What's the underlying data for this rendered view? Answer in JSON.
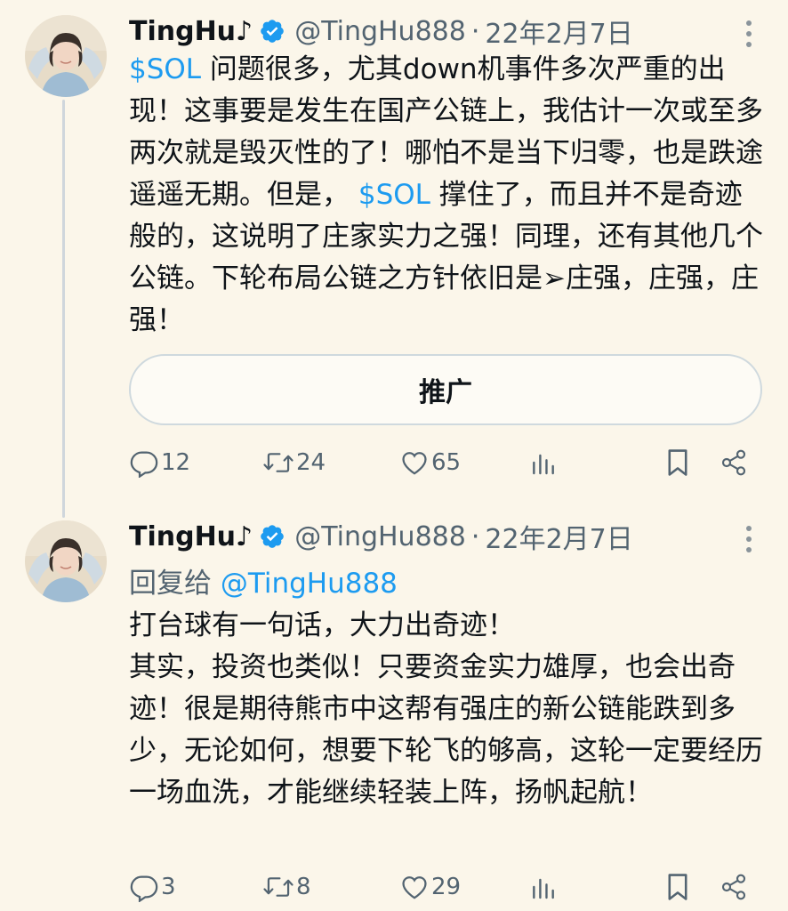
{
  "tweets": [
    {
      "author": {
        "name": "TingHu♪",
        "handle": "@TingHu888",
        "date": "22年2月7日"
      },
      "body": {
        "cashtag1": "$SOL",
        "part1": " 问题很多，尤其down机事件多次严重的出现！这事要是发生在国产公链上，我估计一次或至多两次就是毁灭性的了！哪怕不是当下归零，也是跌途遥遥无期。但是， ",
        "cashtag2": "$SOL",
        "part2": " 撑住了，而且并不是奇迹般的，这说明了庄家实力之强！同理，还有其他几个公链。下轮布局公链之方针依旧是➢庄强，庄强，庄强！"
      },
      "promote_label": "推广",
      "stats": {
        "replies": "12",
        "retweets": "24",
        "likes": "65"
      }
    },
    {
      "author": {
        "name": "TingHu♪",
        "handle": "@TingHu888",
        "date": "22年2月7日"
      },
      "reply_prefix": "回复给 ",
      "reply_handle": "@TingHu888",
      "body": {
        "line1": "打台球有一句话，大力出奇迹！",
        "line2": "其实，投资也类似！只要资金实力雄厚，也会出奇迹！很是期待熊市中这帮有强庄的新公链能跌到多少，无论如何，想要下轮飞的够高，这轮一定要经历一场血洗，才能继续轻装上阵，扬帆起航！"
      },
      "stats": {
        "replies": "3",
        "retweets": "8",
        "likes": "29"
      }
    }
  ],
  "icons": {
    "verified": "verified-badge-icon",
    "more": "more-vertical-icon",
    "reply": "reply-icon",
    "retweet": "retweet-icon",
    "like": "like-icon",
    "views": "views-icon",
    "bookmark": "bookmark-icon",
    "share": "share-icon"
  },
  "colors": {
    "background": "#fbf6ea",
    "link": "#1d9bf0",
    "verified": "#1d9bf0",
    "secondary_text": "#536471",
    "primary_text": "#0f1419"
  }
}
